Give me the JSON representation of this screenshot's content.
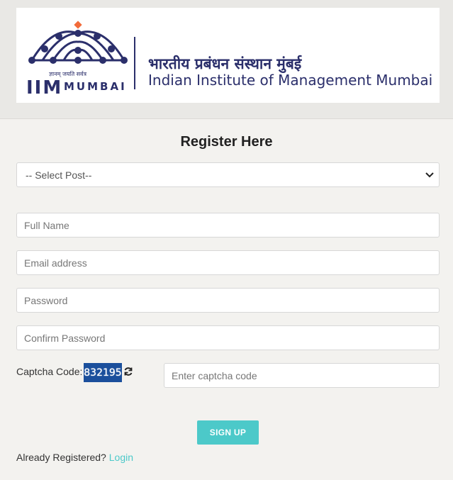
{
  "header": {
    "hindi_name": "भारतीय प्रबंधन संस्थान मुंबई",
    "english_name": "Indian Institute of Management Mumbai",
    "logo_iim": "IIM",
    "logo_mumbai": "MUMBAI",
    "logo_motto": "ज्ञानम् जयति सर्वत्र",
    "brand_color": "#2b2f6b",
    "accent_color": "#f26b3a"
  },
  "form": {
    "title": "Register Here",
    "post_select": {
      "selected": "-- Select Post--"
    },
    "full_name_placeholder": "Full Name",
    "email_placeholder": "Email address",
    "password_placeholder": "Password",
    "confirm_password_placeholder": "Confirm Password",
    "captcha_label": "Captcha Code:",
    "captcha_value": "832195",
    "captcha_placeholder": "Enter captcha code",
    "signup_label": "SIGN UP",
    "already_registered": "Already Registered?",
    "login_label": "Login",
    "button_color": "#4cc9c9",
    "captcha_bg_color": "#1b4f9c"
  },
  "icons": {
    "refresh": "refresh-icon",
    "dropdown": "chevron-down-icon"
  }
}
